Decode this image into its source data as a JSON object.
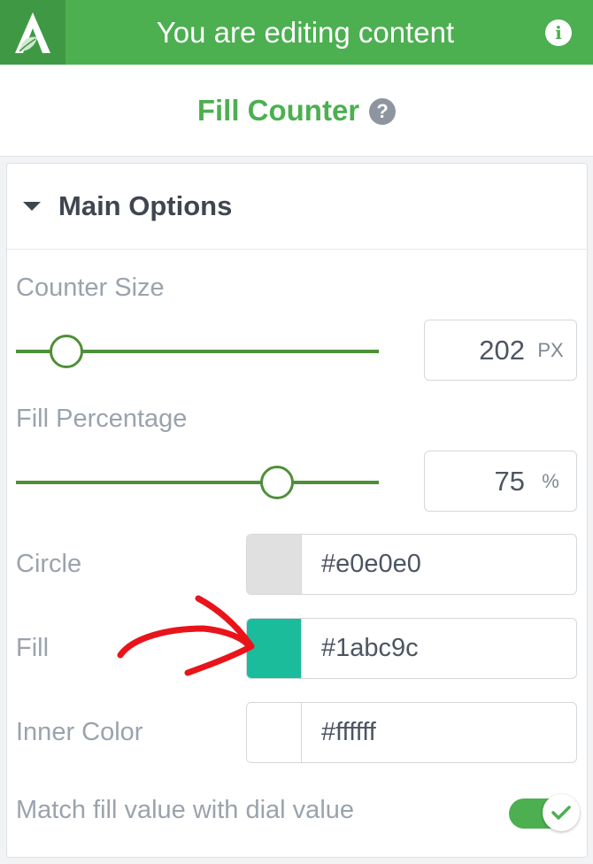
{
  "header": {
    "title": "You are editing content"
  },
  "panel": {
    "title": "Fill Counter"
  },
  "section": {
    "title": "Main Options"
  },
  "fields": {
    "counter_size": {
      "label": "Counter Size",
      "value": "202",
      "unit": "PX",
      "slider_fraction": 0.14
    },
    "fill_percentage": {
      "label": "Fill Percentage",
      "value": "75",
      "unit": "%",
      "slider_fraction": 0.72
    },
    "circle": {
      "label": "Circle",
      "value": "#e0e0e0",
      "swatch": "#e0e0e0"
    },
    "fill": {
      "label": "Fill",
      "value": "#1abc9c",
      "swatch": "#1abc9c"
    },
    "inner_color": {
      "label": "Inner Color",
      "value": "#ffffff",
      "swatch": "#ffffff"
    },
    "match_fill": {
      "label": "Match fill value with dial value",
      "checked": true
    }
  },
  "icons": {
    "logo": "leaf-logo-icon",
    "info": "info-icon",
    "help": "help-icon",
    "caret": "caret-down-icon",
    "check": "check-icon",
    "arrow": "annotation-arrow-icon"
  },
  "colors": {
    "brand": "#4caf50",
    "brand_dark": "#3f9944",
    "slider": "#4e8f39",
    "annotation": "#e8141a"
  }
}
